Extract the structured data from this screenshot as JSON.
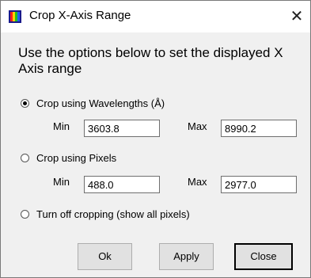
{
  "window": {
    "title": "Crop X-Axis Range",
    "close_glyph": "✕",
    "icon": "app-rainbow-icon"
  },
  "instructions": "Use the options below to set the displayed X Axis range",
  "options": {
    "wavelengths": {
      "label": "Crop using Wavelengths (Å)",
      "checked": true,
      "min_label": "Min",
      "min_value": "3603.8",
      "max_label": "Max",
      "max_value": "8990.2"
    },
    "pixels": {
      "label": "Crop using Pixels",
      "checked": false,
      "min_label": "Min",
      "min_value": "488.0",
      "max_label": "Max",
      "max_value": "2977.0"
    },
    "off": {
      "label": "Turn off cropping (show all pixels)",
      "checked": false
    }
  },
  "buttons": {
    "ok": "Ok",
    "apply": "Apply",
    "close": "Close"
  }
}
